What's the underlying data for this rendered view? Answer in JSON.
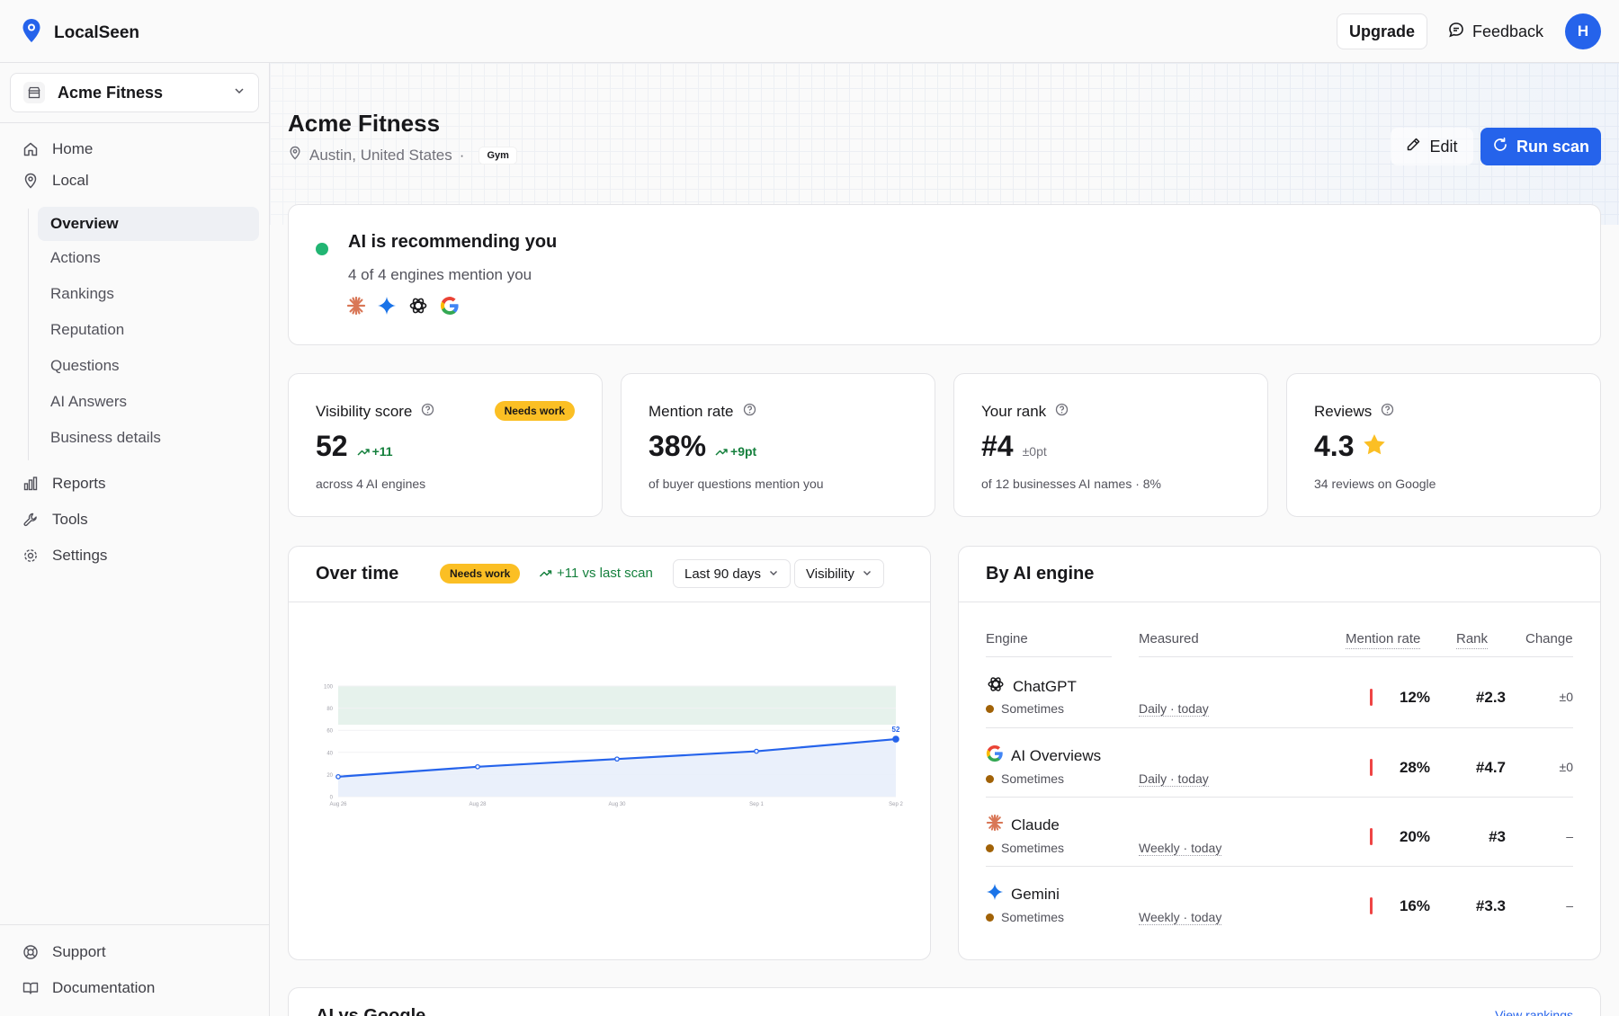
{
  "app": {
    "name": "LocalSeen"
  },
  "topbar": {
    "upgrade_label": "Upgrade",
    "feedback_label": "Feedback",
    "avatar_initial": "H"
  },
  "sidebar": {
    "business": "Acme Fitness",
    "nav": [
      {
        "label": "Home",
        "icon": "home-icon"
      },
      {
        "label": "Local",
        "icon": "map-pin-icon"
      }
    ],
    "subnav": [
      {
        "label": "Overview",
        "active": true
      },
      {
        "label": "Actions"
      },
      {
        "label": "Rankings"
      },
      {
        "label": "Reputation"
      },
      {
        "label": "Questions"
      },
      {
        "label": "AI Answers"
      },
      {
        "label": "Business details"
      }
    ],
    "nav2": [
      {
        "label": "Reports",
        "icon": "bar-chart-icon"
      },
      {
        "label": "Tools",
        "icon": "wrench-icon"
      },
      {
        "label": "Settings",
        "icon": "gear-icon"
      }
    ],
    "footer": [
      {
        "label": "Support",
        "icon": "lifebuoy-icon"
      },
      {
        "label": "Documentation",
        "icon": "book-icon"
      }
    ]
  },
  "header": {
    "title": "Acme Fitness",
    "location": "Austin, United States",
    "separator": "·",
    "category": "Gym",
    "edit_label": "Edit",
    "run_label": "Run scan"
  },
  "recommendation": {
    "title": "AI is recommending you",
    "subtitle": "4 of 4 engines mention you",
    "engines": [
      "claude-icon",
      "gemini-icon",
      "chatgpt-icon",
      "google-icon"
    ]
  },
  "kpis": [
    {
      "title": "Visibility score",
      "badge": "Needs work",
      "value": "52",
      "delta": "+11",
      "sub": "across 4 AI engines"
    },
    {
      "title": "Mention rate",
      "value": "38%",
      "delta": "+9pt",
      "sub": "of buyer questions mention you"
    },
    {
      "title": "Your rank",
      "value": "#4",
      "delta": "±0pt",
      "sub": "of 12 businesses AI names · 8%"
    },
    {
      "title": "Reviews",
      "value": "4.3",
      "sub": "34 reviews on Google"
    }
  ],
  "over_time": {
    "title": "Over time",
    "badge": "Needs work",
    "delta": "+11 vs last scan",
    "range_label": "Last 90 days",
    "metric_label": "Visibility"
  },
  "chart_data": {
    "type": "line",
    "x": [
      "Aug 26",
      "Aug 28",
      "Aug 30",
      "Sep 1",
      "Sep 2"
    ],
    "series": [
      {
        "values": [
          18,
          27,
          34,
          41,
          52
        ]
      }
    ],
    "ylim": [
      0,
      100
    ],
    "yticks": [
      0,
      20,
      40,
      60,
      80,
      100
    ],
    "band": [
      65,
      100
    ],
    "last_label": "52",
    "colors": {
      "line": "#2563eb",
      "band": "#e6f2ec",
      "area": "#e8eefb"
    }
  },
  "by_engine": {
    "title": "By AI engine",
    "headers": {
      "engine": "Engine",
      "measured": "Measured",
      "rate": "Mention rate",
      "rank": "Rank",
      "change": "Change"
    },
    "rows": [
      {
        "name": "ChatGPT",
        "icon": "chatgpt-icon",
        "freq": "Sometimes",
        "measured": "Daily · today",
        "rate": "12%",
        "rank": "#2.3",
        "change": "±0"
      },
      {
        "name": "AI Overviews",
        "icon": "google-icon",
        "freq": "Sometimes",
        "measured": "Daily · today",
        "rate": "28%",
        "rank": "#4.7",
        "change": "±0"
      },
      {
        "name": "Claude",
        "icon": "claude-icon",
        "freq": "Sometimes",
        "measured": "Weekly · today",
        "rate": "20%",
        "rank": "#3",
        "change": "–"
      },
      {
        "name": "Gemini",
        "icon": "gemini-icon",
        "freq": "Sometimes",
        "measured": "Weekly · today",
        "rate": "16%",
        "rank": "#3.3",
        "change": "–"
      }
    ]
  },
  "ai_vs_google": {
    "title": "AI vs Google",
    "link": "View rankings"
  }
}
